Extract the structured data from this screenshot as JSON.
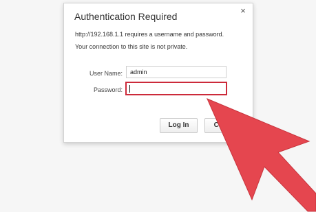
{
  "dialog": {
    "title": "Authentication Required",
    "close_glyph": "×",
    "message_line1": "http://192.168.1.1 requires a username and password.",
    "message_line2": "Your connection to this site is not private."
  },
  "form": {
    "username_label": "User Name:",
    "username_value": "admin",
    "password_label": "Password:",
    "password_value": ""
  },
  "buttons": {
    "login_label": "Log In",
    "cancel_label": "Cancel"
  },
  "annotation": {
    "arrow_icon": "pointer-arrow-icon",
    "arrow_color": "#e5464f",
    "highlight_color": "#cc2a3a"
  }
}
